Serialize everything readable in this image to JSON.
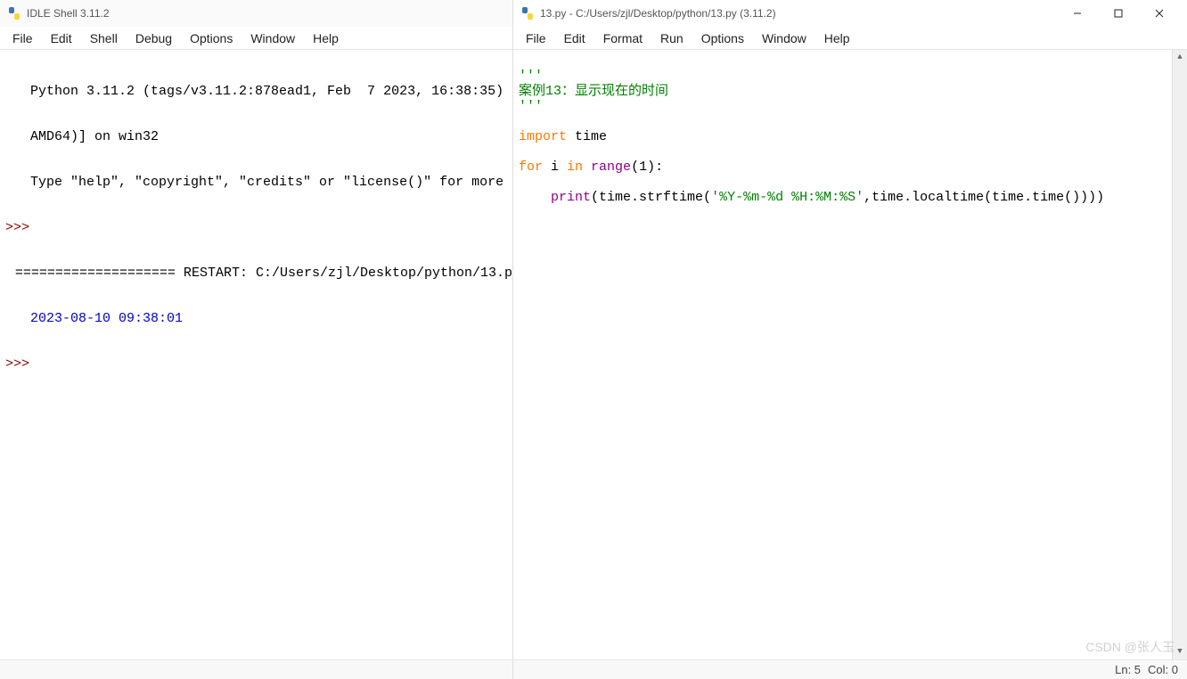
{
  "shell": {
    "title": "IDLE Shell 3.11.2",
    "menu": [
      "File",
      "Edit",
      "Shell",
      "Debug",
      "Options",
      "Window",
      "Help"
    ],
    "lines": {
      "l1": "Python 3.11.2 (tags/v3.11.2:878ead1, Feb  7 2023, 16:38:35) ",
      "l2": "AMD64)] on win32",
      "l3": "Type \"help\", \"copyright\", \"credits\" or \"license()\" for more ",
      "prompt1": ">>>",
      "restart": "==================== RESTART: C:/Users/zjl/Desktop/python/13.p",
      "output": "2023-08-10 09:38:01",
      "prompt2": ">>>"
    }
  },
  "editor": {
    "title": "13.py - C:/Users/zjl/Desktop/python/13.py (3.11.2)",
    "menu": [
      "File",
      "Edit",
      "Format",
      "Run",
      "Options",
      "Window",
      "Help"
    ],
    "code": {
      "c1": "'''",
      "c2": "案例13：显示现在的时间",
      "c3": "'''",
      "import_kw": "import",
      "import_mod": " time",
      "for_kw": "for",
      "for_var": " i ",
      "in_kw": "in",
      "range_fn": " range",
      "range_arg": "(1):",
      "indent": "    ",
      "print_fn": "print",
      "open_paren": "(time.strftime(",
      "fmt_str": "'%Y-%m-%d %H:%M:%S'",
      "rest": ",time.localtime(time.time())))"
    },
    "status": {
      "ln": "Ln: 5",
      "col": "Col: 0"
    }
  },
  "watermark": "CSDN @张人玉"
}
